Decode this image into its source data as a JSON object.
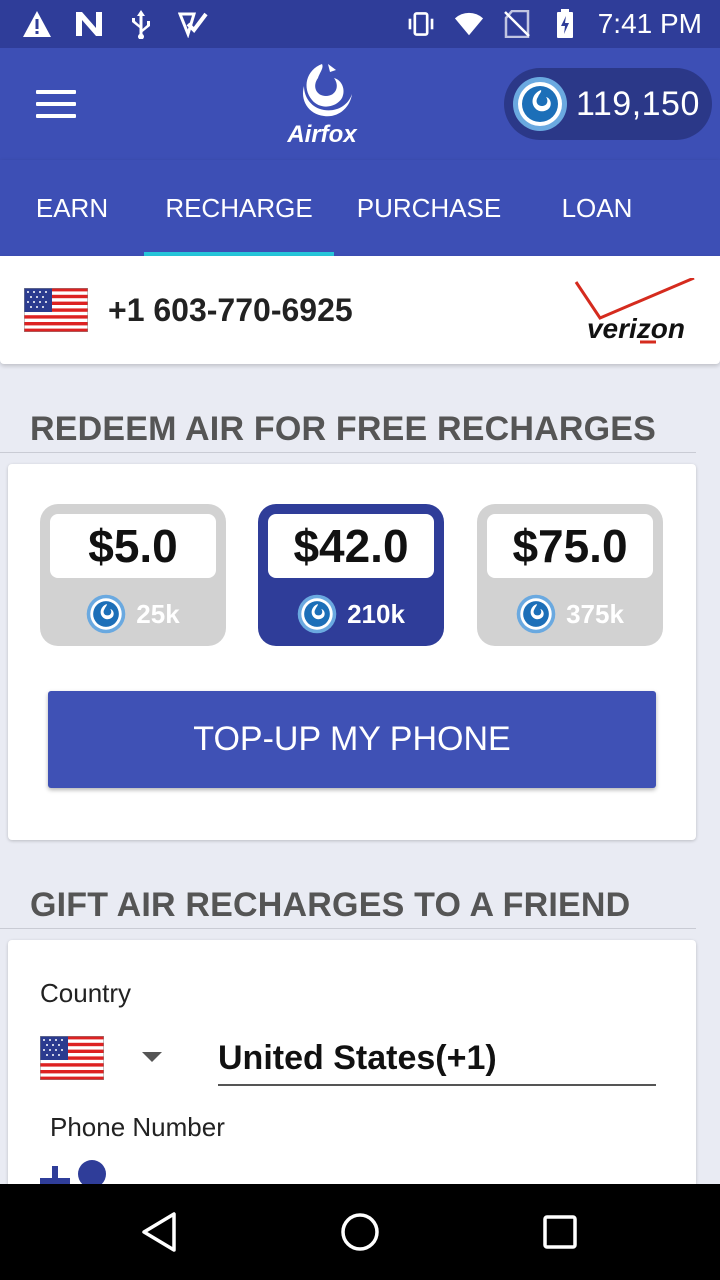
{
  "status_bar": {
    "time": "7:41 PM",
    "left_icons": [
      "warning-icon",
      "n-icon",
      "usb-icon",
      "check-icon"
    ],
    "right_icons": [
      "vibrate-icon",
      "wifi-icon",
      "no-sim-icon",
      "battery-icon"
    ]
  },
  "app_bar": {
    "logo_text": "Airfox",
    "balance": "119,150"
  },
  "tabs": [
    {
      "label": "EARN",
      "active": false
    },
    {
      "label": "RECHARGE",
      "active": true
    },
    {
      "label": "PURCHASE",
      "active": false
    },
    {
      "label": "LOAN",
      "active": false
    }
  ],
  "phone_card": {
    "number": "+1 603-770-6925",
    "carrier": "verizon"
  },
  "redeem": {
    "title": "REDEEM AIR FOR FREE RECHARGES",
    "options": [
      {
        "price": "$5.0",
        "cost": "25k",
        "selected": false
      },
      {
        "price": "$42.0",
        "cost": "210k",
        "selected": true
      },
      {
        "price": "$75.0",
        "cost": "375k",
        "selected": false
      }
    ],
    "button_label": "TOP-UP MY PHONE"
  },
  "gift": {
    "title": "GIFT AIR RECHARGES TO A FRIEND",
    "country_label": "Country",
    "country_value": "United States(+1)",
    "phone_label": "Phone Number"
  },
  "colors": {
    "primary": "#3d4fb5",
    "primary_dark": "#2f3d99",
    "accent": "#26c6da"
  }
}
